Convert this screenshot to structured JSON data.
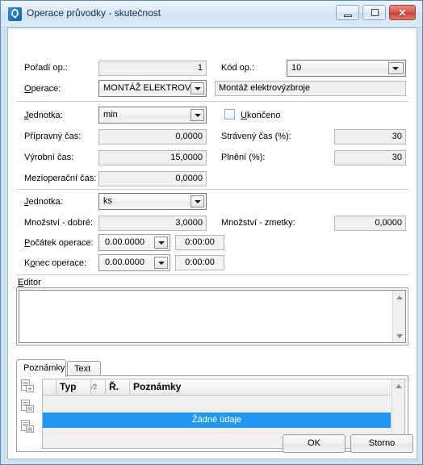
{
  "window": {
    "title": "Operace průvodky - skutečnost",
    "icon": "app-icon",
    "controls": {
      "minimize": "minimize-icon",
      "maximize": "maximize-icon",
      "close": "✕"
    }
  },
  "section_operation": {
    "order_label": "Pořadí op.:",
    "order_value": "1",
    "code_label": "Kód op.:",
    "code_value": "10",
    "operation_label": "Operace:",
    "operation_value": "MONTÁŽ ELEKTROVÝZ.",
    "operation_description": "Montáž elektrovýzbroje"
  },
  "section_times": {
    "unit_label": "Jednotka:",
    "unit_value": "min",
    "finished_label": "Ukončeno",
    "finished_checked": false,
    "prep_time_label": "Přípravný čas:",
    "prep_time_value": "0,0000",
    "spent_time_label": "Strávený čas (%):",
    "spent_time_value": "30",
    "prod_time_label": "Výrobní čas:",
    "prod_time_value": "15,0000",
    "fulfillment_label": "Plnění (%):",
    "fulfillment_value": "30",
    "interop_time_label": "Mezioperační čas:",
    "interop_time_value": "0,0000"
  },
  "section_quantity": {
    "unit_label": "Jednotka:",
    "unit_value": "ks",
    "good_qty_label": "Množství - dobré:",
    "good_qty_value": "3,0000",
    "scrap_qty_label": "Množství - zmetky:",
    "scrap_qty_value": "0,0000",
    "start_label": "Počátek operace:",
    "start_date": "0.00.0000",
    "start_time": "0:00:00",
    "end_label": "Konec operace:",
    "end_date": "0.00.0000",
    "end_time": "0:00:00"
  },
  "editor": {
    "label": "Editor",
    "value": ""
  },
  "tabs": [
    {
      "label": "Poznámky",
      "active": true
    },
    {
      "label": "Text",
      "active": false
    }
  ],
  "grid": {
    "tools": [
      "add-note-icon",
      "view-note-icon",
      "save-note-icon"
    ],
    "columns": [
      "Typ",
      "Ř.",
      "Poznámky"
    ],
    "sort_indicator": "2",
    "empty_message": "Žádné údaje"
  },
  "footer": {
    "ok_label": "OK",
    "cancel_label": "Storno"
  },
  "colors": {
    "selection": "#2196f3",
    "frame": "#cfe0ef",
    "close_button": "#c63f33"
  }
}
